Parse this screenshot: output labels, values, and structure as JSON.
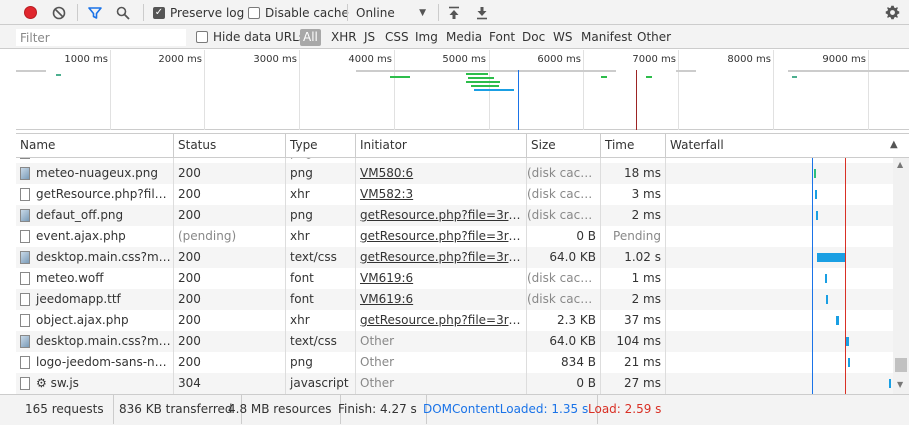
{
  "toolbar": {
    "preserve_log_label": "Preserve log",
    "preserve_log_checked": true,
    "disable_cache_label": "Disable cache",
    "disable_cache_checked": false,
    "throttle_value": "Online"
  },
  "filter": {
    "placeholder": "Filter",
    "hide_data_urls_label": "Hide data URLs",
    "types": [
      "All",
      "XHR",
      "JS",
      "CSS",
      "Img",
      "Media",
      "Font",
      "Doc",
      "WS",
      "Manifest",
      "Other"
    ],
    "active_type": "All"
  },
  "overview": {
    "ticks": [
      "1000 ms",
      "2000 ms",
      "3000 ms",
      "4000 ms",
      "5000 ms",
      "6000 ms",
      "7000 ms",
      "8000 ms",
      "9000 ms"
    ]
  },
  "table": {
    "columns": [
      "Name",
      "Status",
      "Type",
      "Initiator",
      "Size",
      "Time",
      "Waterfall"
    ],
    "rows": [
      {
        "name": "meteo-nuageux.png",
        "icon": "image",
        "status": "200",
        "type": "png",
        "initiator": "VM580:6",
        "initiator_link": true,
        "size": "(disk cache)",
        "time": "18 ms"
      },
      {
        "name": "getResource.php?file=...",
        "icon": "doc",
        "status": "200",
        "type": "xhr",
        "initiator": "VM582:3",
        "initiator_link": true,
        "size": "(disk cache)",
        "time": "3 ms"
      },
      {
        "name": "defaut_off.png",
        "icon": "image",
        "status": "200",
        "type": "png",
        "initiator": "getResource.php?file=3rdpa...",
        "initiator_link": true,
        "size": "(disk cache)",
        "time": "2 ms"
      },
      {
        "name": "event.ajax.php",
        "icon": "doc",
        "status": "(pending)",
        "type": "xhr",
        "initiator": "getResource.php?file=3rdpa...",
        "initiator_link": true,
        "size": "0 B",
        "time": "Pending"
      },
      {
        "name": "desktop.main.css?md5...",
        "icon": "image",
        "status": "200",
        "type": "text/css",
        "initiator": "getResource.php?file=3rdpa...",
        "initiator_link": true,
        "size": "64.0 KB",
        "time": "1.02 s"
      },
      {
        "name": "meteo.woff",
        "icon": "doc",
        "status": "200",
        "type": "font",
        "initiator": "VM619:6",
        "initiator_link": true,
        "size": "(disk cache)",
        "time": "1 ms"
      },
      {
        "name": "jeedomapp.ttf",
        "icon": "doc",
        "status": "200",
        "type": "font",
        "initiator": "VM619:6",
        "initiator_link": true,
        "size": "(disk cache)",
        "time": "2 ms"
      },
      {
        "name": "object.ajax.php",
        "icon": "doc",
        "status": "200",
        "type": "xhr",
        "initiator": "getResource.php?file=3rdpa...",
        "initiator_link": true,
        "size": "2.3 KB",
        "time": "37 ms"
      },
      {
        "name": "desktop.main.css?md5...",
        "icon": "image",
        "status": "200",
        "type": "text/css",
        "initiator": "Other",
        "initiator_link": false,
        "size": "64.0 KB",
        "time": "104 ms"
      },
      {
        "name": "logo-jeedom-sans-no...",
        "icon": "doc",
        "status": "200",
        "type": "png",
        "initiator": "Other",
        "initiator_link": false,
        "size": "834 B",
        "time": "21 ms"
      },
      {
        "name": "⚙ sw.js",
        "icon": "doc",
        "status": "304",
        "type": "javascript",
        "initiator": "Other",
        "initiator_link": false,
        "size": "0 B",
        "time": "27 ms"
      }
    ]
  },
  "status": {
    "requests": "165 requests",
    "transferred": "836 KB transferred",
    "resources": "4.8 MB resources",
    "finish": "Finish: 4.27 s",
    "dom_content_loaded": "DOMContentLoaded: 1.35 s",
    "load": "Load: 2.59 s",
    "dcl_color": "#1a73e8",
    "load_color": "#d93025"
  }
}
